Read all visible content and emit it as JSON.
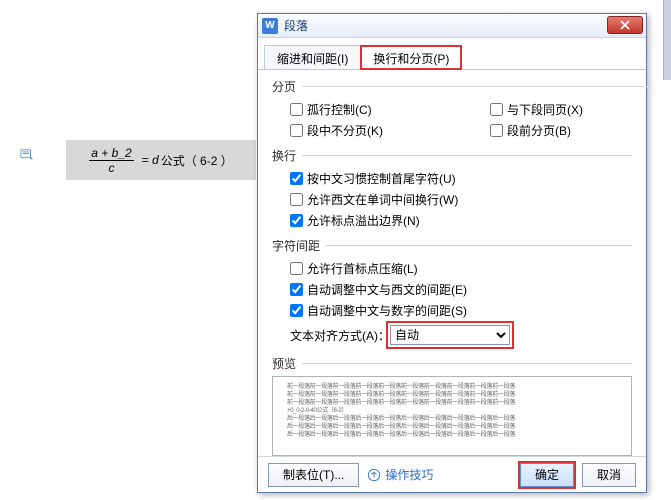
{
  "document": {
    "formula_numer": "a + b_2",
    "formula_denom": "c",
    "formula_eq": " = d",
    "formula_label": "公式（ 6-2 ）"
  },
  "dialog": {
    "app_glyph": "W",
    "title": "段落",
    "tabs": {
      "indent": "缩进和间距(I)",
      "page": "换行和分页(P)"
    },
    "groups": {
      "paging": {
        "title": "分页",
        "orphan": "孤行控制(C)",
        "keep_next": "与下段同页(X)",
        "keep_lines": "段中不分页(K)",
        "page_break": "段前分页(B)"
      },
      "wrap": {
        "title": "换行",
        "cn_first_last": "按中文习惯控制首尾字符(U)",
        "latin_wrap": "允许西文在单词中间换行(W)",
        "punct_overflow": "允许标点溢出边界(N)"
      },
      "spacing": {
        "title": "字符间距",
        "punct_compress": "允许行首标点压缩(L)",
        "cn_latin": "自动调整中文与西文的间距(E)",
        "cn_digit": "自动调整中文与数字的间距(S)",
        "align_label": "文本对齐方式(A)：",
        "align_value": "自动"
      },
      "preview": {
        "title": "预览",
        "line": "前一段落前一段落前一段落前一段落前一段落前一段落前一段落前一段落前一段落前一段落",
        "formula_line": "+0_0-2-0-40公式（6-2）",
        "after": "后一段落后一段落后一段落后一段落后一段落后一段落后一段落后一段落后一段落后一段落"
      }
    },
    "footer": {
      "tabstops": "制表位(T)...",
      "help": "操作技巧",
      "ok": "确定",
      "cancel": "取消"
    }
  }
}
